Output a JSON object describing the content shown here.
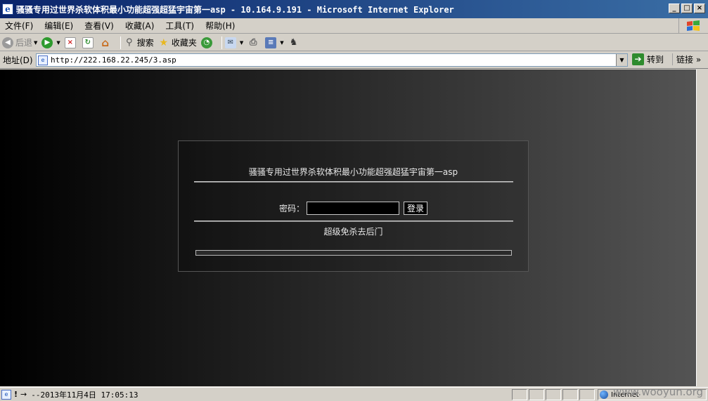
{
  "window": {
    "title": "骚骚专用过世界杀软体积最小功能超强超猛宇宙第一asp - 10.164.9.191 - Microsoft Internet Explorer",
    "buttons": [
      "_",
      "□",
      "×"
    ]
  },
  "menu": [
    "文件(F)",
    "编辑(E)",
    "查看(V)",
    "收藏(A)",
    "工具(T)",
    "帮助(H)"
  ],
  "toolbar": {
    "back_label": "后退",
    "search_label": "搜索",
    "favorites_label": "收藏夹"
  },
  "address": {
    "label": "地址(D)",
    "url": "http://222.168.22.245/3.asp",
    "go_label": "转到",
    "links_label": "链接"
  },
  "page": {
    "title": "骚骚专用过世界杀软体积最小功能超强超猛宇宙第一asp",
    "password_label": "密码：",
    "password_value": "",
    "login_label": "登录",
    "subtitle": "超级免杀去后门"
  },
  "status": {
    "text": "--2013年11月4日 17:05:13",
    "zone": "Internet",
    "watermark": "www.wooyun.org"
  },
  "colors": {
    "titlebar_start": "#0a246a",
    "chrome": "#d4d0c8",
    "page_bg_left": "#000000",
    "page_bg_right": "#545454"
  }
}
